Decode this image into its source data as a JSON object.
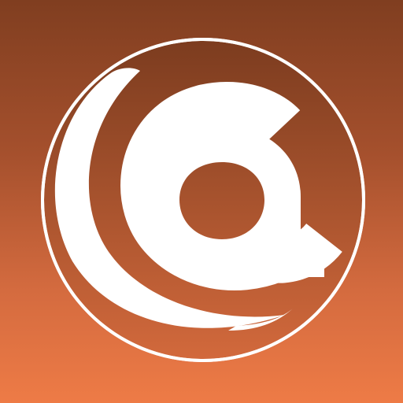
{
  "app_icon": {
    "name": "email-at-sign-icon",
    "symbol": "@",
    "colors": {
      "background_top": "#803e20",
      "background_bottom": "#ee7b46",
      "disc_top": "#7c3c1f",
      "disc_bottom": "#d2693c",
      "glyph": "#ffffff"
    }
  }
}
